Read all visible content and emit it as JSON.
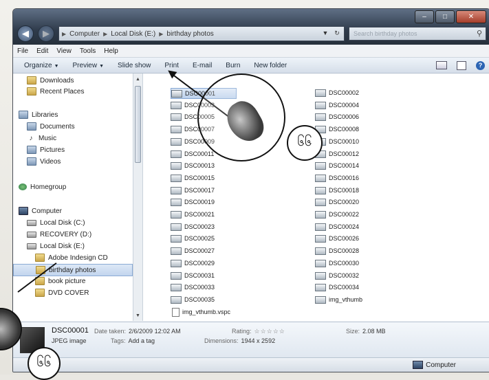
{
  "window": {
    "controls": {
      "minimize": "–",
      "maximize": "□",
      "close": "✕"
    }
  },
  "address": {
    "back": "◀",
    "forward": "▶",
    "crumbs": [
      "Computer",
      "Local Disk (E:)",
      "birthday photos"
    ],
    "search_placeholder": "Search birthday photos"
  },
  "menu": [
    "File",
    "Edit",
    "View",
    "Tools",
    "Help"
  ],
  "toolbar": {
    "organize": "Organize",
    "preview": "Preview",
    "slideshow": "Slide show",
    "print": "Print",
    "email": "E-mail",
    "burn": "Burn",
    "new_folder": "New folder"
  },
  "nav": [
    {
      "label": "Downloads",
      "icon": "folder-icon"
    },
    {
      "label": "Recent Places",
      "icon": "folder-icon"
    },
    {
      "label": "Libraries",
      "icon": "library-icon"
    },
    {
      "label": "Documents",
      "icon": "library-icon"
    },
    {
      "label": "Music",
      "icon": "music-icon"
    },
    {
      "label": "Pictures",
      "icon": "library-icon"
    },
    {
      "label": "Videos",
      "icon": "library-icon"
    },
    {
      "label": "Homegroup",
      "icon": "homegroup-icon"
    },
    {
      "label": "Computer",
      "icon": "computer-icon"
    },
    {
      "label": "Local Disk (C:)",
      "icon": "drive-icon"
    },
    {
      "label": "RECOVERY (D:)",
      "icon": "drive-icon"
    },
    {
      "label": "Local Disk (E:)",
      "icon": "drive-icon"
    },
    {
      "label": "Adobe Indesign CD",
      "icon": "folder-icon"
    },
    {
      "label": "birthday photos",
      "icon": "folder-icon"
    },
    {
      "label": "book picture",
      "icon": "folder-icon"
    },
    {
      "label": "DVD COVER",
      "icon": "folder-icon"
    }
  ],
  "files_left": [
    "DSC00001",
    "DSC00003",
    "DSC00005",
    "DSC00007",
    "DSC00009",
    "DSC00011",
    "DSC00013",
    "DSC00015",
    "DSC00017",
    "DSC00019",
    "DSC00021",
    "DSC00023",
    "DSC00025",
    "DSC00027",
    "DSC00029",
    "DSC00031",
    "DSC00033",
    "DSC00035",
    "img_vthumb.vspc"
  ],
  "files_right": [
    "DSC00002",
    "DSC00004",
    "DSC00006",
    "DSC00008",
    "DSC00010",
    "DSC00012",
    "DSC00014",
    "DSC00016",
    "DSC00018",
    "DSC00020",
    "DSC00022",
    "DSC00024",
    "DSC00026",
    "DSC00028",
    "DSC00030",
    "DSC00032",
    "DSC00034",
    "img_vthumb"
  ],
  "details": {
    "name": "DSC00001",
    "type": "JPEG image",
    "date_label": "Date taken:",
    "date": "2/6/2009 12:02 AM",
    "tags_label": "Tags:",
    "tags": "Add a tag",
    "rating_label": "Rating:",
    "rating_stars": "☆☆☆☆☆",
    "dimensions_label": "Dimensions:",
    "dimensions": "1944 x 2592",
    "size_label": "Size:",
    "size": "2.08 MB"
  },
  "status": {
    "computer": "Computer"
  },
  "annotations": {
    "step_badge_1": "၆၆",
    "step_badge_2": "၆၆"
  },
  "colors": {
    "titlebar": "#2f3b4b",
    "selection": "#c2d5ee",
    "help": "#2b64b3"
  }
}
